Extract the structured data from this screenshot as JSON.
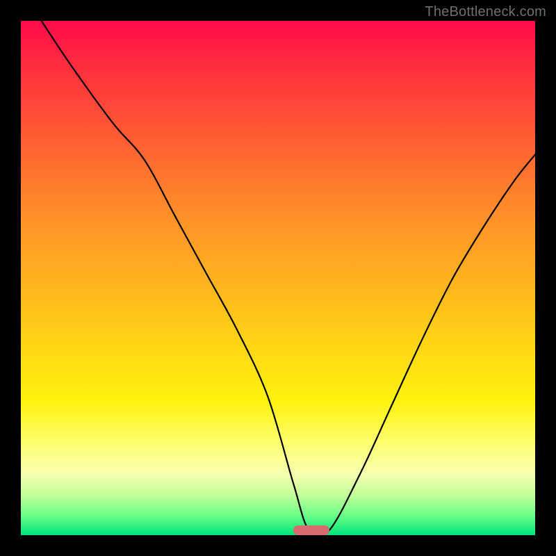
{
  "watermark": {
    "text": "TheBottleneck.com"
  },
  "colors": {
    "background": "#000000",
    "curve": "#000000",
    "marker": "#d96b6e",
    "gradient_stops": [
      "#ff0a4a",
      "#ff2b3f",
      "#ff5a33",
      "#ff8a2a",
      "#ffb11f",
      "#ffd814",
      "#fff20e",
      "#feff6e",
      "#f6ffae",
      "#c6ff9a",
      "#6fff88",
      "#00e57a"
    ]
  },
  "chart_data": {
    "type": "line",
    "title": "",
    "xlabel": "",
    "ylabel": "",
    "xlim": [
      0,
      100
    ],
    "ylim": [
      0,
      100
    ],
    "marker": {
      "x_start": 53,
      "x_end": 60,
      "y": 1
    },
    "series": [
      {
        "name": "bottleneck-curve",
        "x": [
          4,
          10,
          18,
          24,
          30,
          36,
          42,
          48,
          53,
          56,
          60,
          66,
          72,
          78,
          84,
          90,
          96,
          100
        ],
        "y": [
          100,
          91,
          80,
          73,
          62,
          51,
          40,
          27,
          10,
          1,
          1,
          12,
          25,
          38,
          50,
          60,
          69,
          74
        ]
      }
    ]
  }
}
